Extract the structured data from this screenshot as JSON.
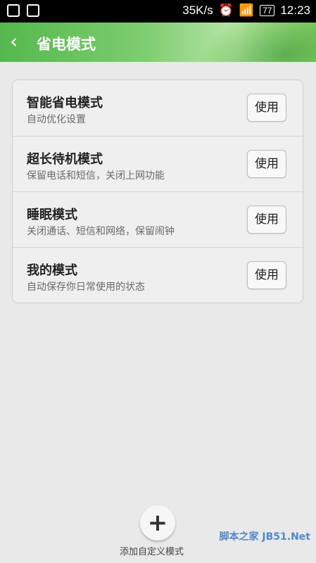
{
  "status_bar": {
    "speed": "35K/s",
    "battery": "77",
    "time": "12:23"
  },
  "header": {
    "title": "省电模式"
  },
  "modes": [
    {
      "name": "智能省电模式",
      "desc": "自动优化设置",
      "button": "使用"
    },
    {
      "name": "超长待机模式",
      "desc": "保留电话和短信，关闭上网功能",
      "button": "使用"
    },
    {
      "name": "睡眠模式",
      "desc": "关闭通话、短信和网络，保留闹钟",
      "button": "使用"
    },
    {
      "name": "我的模式",
      "desc": "自动保存你日常使用的状态",
      "button": "使用"
    }
  ],
  "add": {
    "label": "添加自定义模式"
  },
  "watermark": {
    "text": "脚本之家 JB51.Net"
  }
}
